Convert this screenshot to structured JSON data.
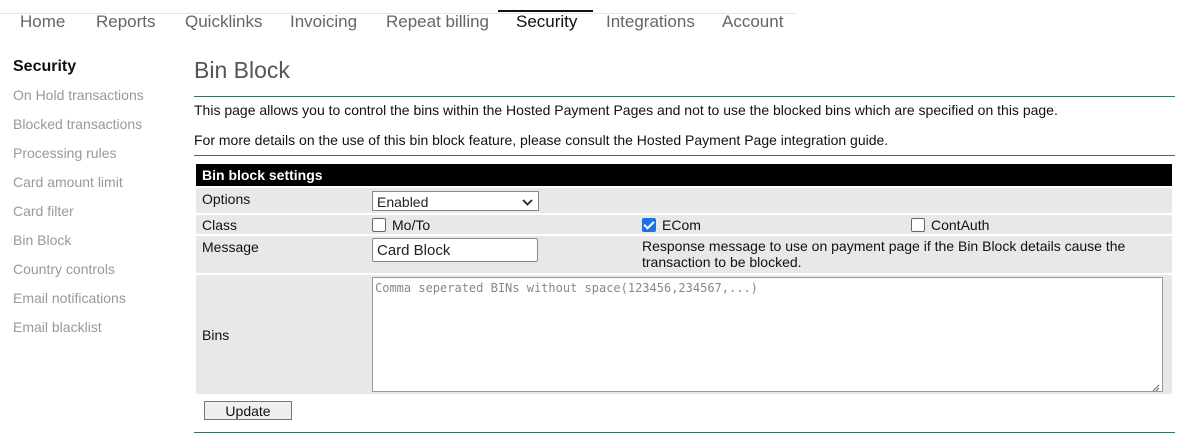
{
  "nav": {
    "tabs": [
      {
        "label": "Home"
      },
      {
        "label": "Reports"
      },
      {
        "label": "Quicklinks"
      },
      {
        "label": "Invoicing"
      },
      {
        "label": "Repeat billing"
      },
      {
        "label": "Security"
      },
      {
        "label": "Integrations"
      },
      {
        "label": "Account"
      }
    ],
    "active": "Security"
  },
  "sidebar": {
    "title": "Security",
    "items": [
      {
        "label": "On Hold transactions"
      },
      {
        "label": "Blocked transactions"
      },
      {
        "label": "Processing rules"
      },
      {
        "label": "Card amount limit"
      },
      {
        "label": "Card filter"
      },
      {
        "label": "Bin Block"
      },
      {
        "label": "Country controls"
      },
      {
        "label": "Email notifications"
      },
      {
        "label": "Email blacklist"
      }
    ]
  },
  "main": {
    "title": "Bin Block",
    "intro1": "This page allows you to control the bins within the Hosted Payment Pages and not to use the blocked bins which are specified on this page.",
    "intro2": "For more details on the use of this bin block feature, please consult the Hosted Payment Page integration guide."
  },
  "settings": {
    "header": "Bin block settings",
    "options": {
      "label": "Options",
      "selected": "Enabled"
    },
    "class": {
      "label": "Class",
      "checkboxes": [
        {
          "label": "Mo/To",
          "checked": false
        },
        {
          "label": "ECom",
          "checked": true
        },
        {
          "label": "ContAuth",
          "checked": false
        }
      ]
    },
    "message": {
      "label": "Message",
      "value": "Card Block",
      "help": "Response message to use on payment page if the Bin Block details cause the transaction to be blocked."
    },
    "bins": {
      "label": "Bins",
      "placeholder": "Comma seperated BINs without space(123456,234567,...)"
    },
    "update_label": "Update"
  },
  "colors": {
    "accent_rule": "#3b6e5c",
    "header_bg": "#000000",
    "row_bg": "#e8e8e8",
    "checkbox_on": "#1a73e8"
  }
}
